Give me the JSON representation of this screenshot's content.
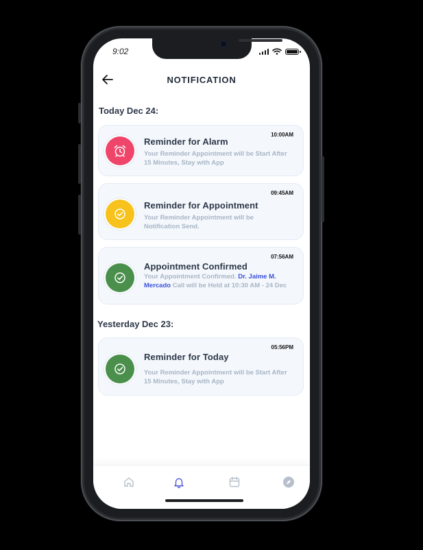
{
  "status_bar": {
    "time": "9:02"
  },
  "header": {
    "title": "NOTIFICATION"
  },
  "sections": [
    {
      "title": "Today Dec 24:"
    },
    {
      "title": "Yesterday Dec 23:"
    }
  ],
  "notifications": [
    {
      "title": "Reminder for Alarm",
      "time": "10:00AM",
      "description": "Your Reminder Appointment will be Start After 15 Minutes, Stay with App",
      "icon": "alarm-clock-icon",
      "color": "#f0456a"
    },
    {
      "title": "Reminder for Appointment",
      "time": "09:45AM",
      "description": "Your Reminder Appointment will be Notification Send.",
      "icon": "check-circle-icon",
      "color": "#f6c21b"
    },
    {
      "title": "Appointment Confirmed",
      "time": "07:56AM",
      "description_prefix": "Your Appointment Confirmed.",
      "doctor": "Dr. Jaime M. Mercado",
      "description_suffix": "Call will be Held at 10:30 AM - 24 Dec",
      "icon": "check-circle-icon",
      "color": "#4a8f4c"
    },
    {
      "title": "Reminder for Today",
      "time": "05:56PM",
      "description": "Your Reminder Appointment will be Start After 15 Minutes, Stay with App",
      "icon": "check-circle-icon",
      "color": "#4a8f4c"
    }
  ],
  "bottom_nav": [
    {
      "icon": "home-icon",
      "active": false
    },
    {
      "icon": "bell-icon",
      "active": true
    },
    {
      "icon": "calendar-icon",
      "active": false
    },
    {
      "icon": "compass-icon",
      "active": false
    }
  ],
  "colors": {
    "accent": "#4f5bd5",
    "text_primary": "#2d3748",
    "text_muted": "#a7b4c4",
    "card_bg": "#f4f8fd"
  }
}
